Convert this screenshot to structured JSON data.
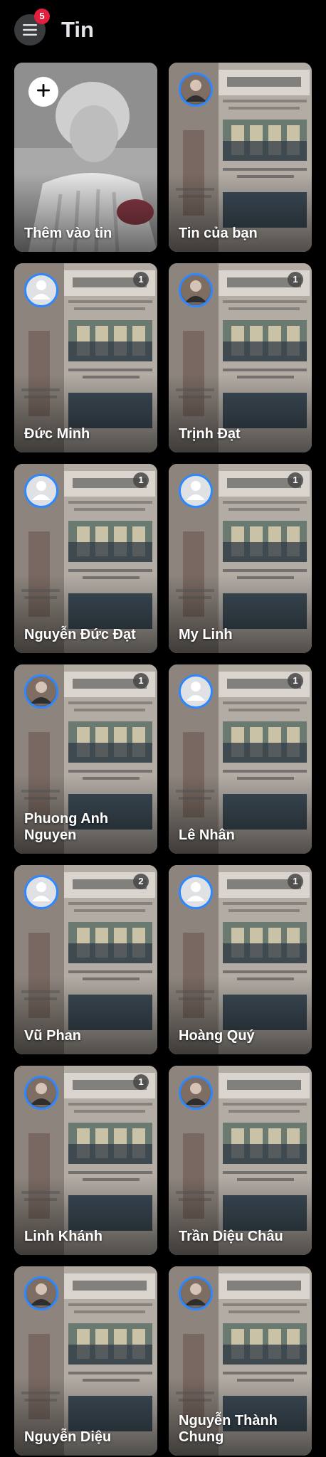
{
  "header": {
    "title": "Tin",
    "menu_icon": "hamburger-menu-icon",
    "notification_count": "5"
  },
  "colors": {
    "background": "#000000",
    "accent_ring": "#2d88ff",
    "badge": "#e41e3f"
  },
  "create_card": {
    "label": "Thêm vào tin",
    "icon": "plus-icon"
  },
  "stories": [
    {
      "name": "Tin của bạn",
      "count": "",
      "avatar": "photo"
    },
    {
      "name": "Đức Minh",
      "count": "1",
      "avatar": "default"
    },
    {
      "name": "Trịnh Đạt",
      "count": "1",
      "avatar": "photo"
    },
    {
      "name": "Nguyễn Đức Đạt",
      "count": "1",
      "avatar": "default"
    },
    {
      "name": "My Linh",
      "count": "1",
      "avatar": "default"
    },
    {
      "name": "Phuong Anh Nguyen",
      "count": "1",
      "avatar": "photo"
    },
    {
      "name": "Lê Nhân",
      "count": "1",
      "avatar": "default"
    },
    {
      "name": "Vũ Phan",
      "count": "2",
      "avatar": "default"
    },
    {
      "name": "Hoàng Quý",
      "count": "1",
      "avatar": "default"
    },
    {
      "name": "Linh Khánh",
      "count": "1",
      "avatar": "photo"
    },
    {
      "name": "Trần Diệu Châu",
      "count": "",
      "avatar": "photo"
    },
    {
      "name": "Nguyễn Diệu",
      "count": "",
      "avatar": "photo"
    },
    {
      "name": "Nguyễn Thành Chung",
      "count": "",
      "avatar": "photo"
    }
  ]
}
